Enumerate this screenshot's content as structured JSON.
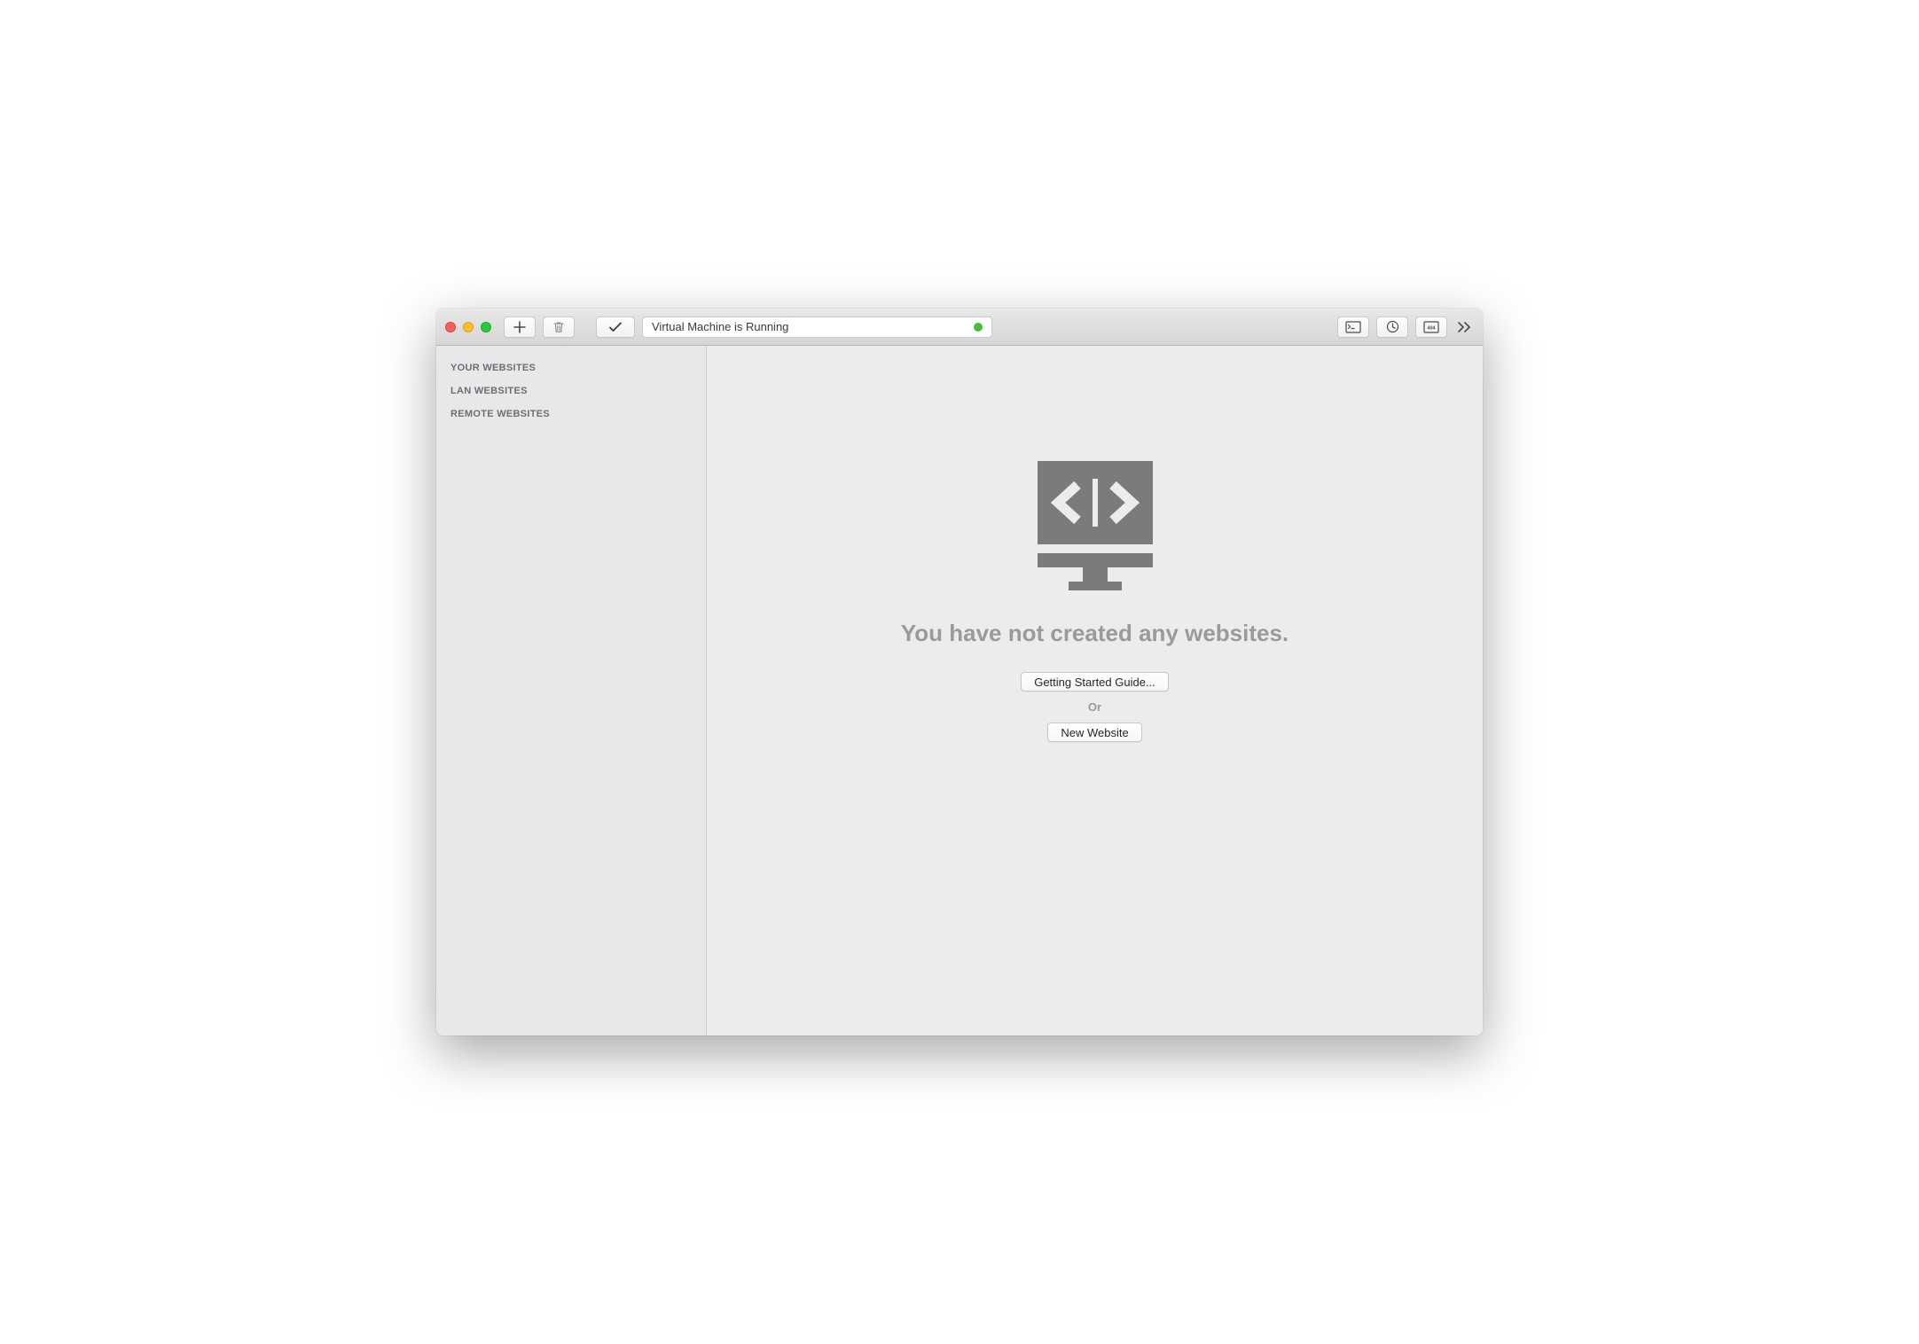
{
  "toolbar": {
    "status_text": "Virtual Machine is Running",
    "status_color": "#3ec23e"
  },
  "sidebar": {
    "sections": [
      {
        "label": "YOUR WEBSITES"
      },
      {
        "label": "LAN WEBSITES"
      },
      {
        "label": "REMOTE WEBSITES"
      }
    ]
  },
  "main": {
    "empty_heading": "You have not created any websites.",
    "getting_started_label": "Getting Started Guide...",
    "or_label": "Or",
    "new_website_label": "New Website"
  }
}
